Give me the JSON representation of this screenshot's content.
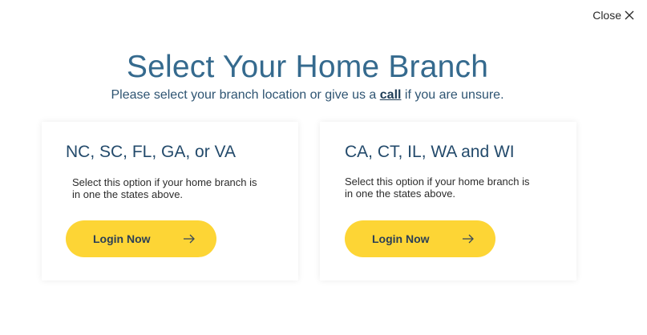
{
  "close": {
    "label": "Close"
  },
  "header": {
    "title": "Select Your Home Branch",
    "subtitle_before": "Please select your branch location or give us a ",
    "subtitle_link": "call",
    "subtitle_after": " if you are unsure."
  },
  "cards": [
    {
      "heading": "NC, SC, FL, GA, or VA",
      "description": "Select this option if your home branch is in one the states above.",
      "button_label": "Login Now"
    },
    {
      "heading": "CA, CT, IL, WA and WI",
      "description": "Select this option if your home branch is in one the states above.",
      "button_label": "Login Now"
    }
  ],
  "colors": {
    "accent_yellow": "#fdd535",
    "title_blue": "#356a8e",
    "heading_navy": "#234a6b"
  },
  "icons": {
    "close": "close-icon",
    "arrow": "arrow-right-icon"
  }
}
